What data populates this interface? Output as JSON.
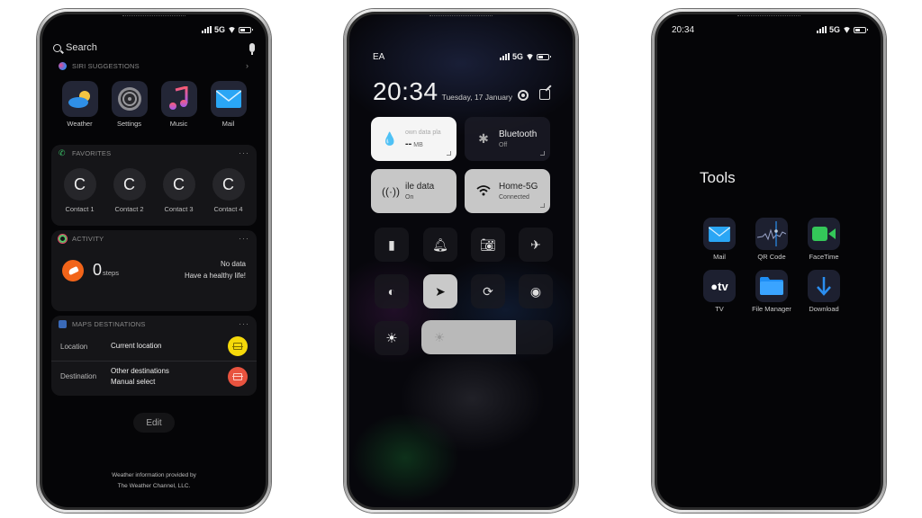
{
  "phones": {
    "today_view": {
      "status": {
        "signal": "signal-icon",
        "network": "5G",
        "wifi": "wifi-icon",
        "battery": "battery-icon"
      },
      "search": {
        "placeholder": "Search",
        "icon": "search-icon",
        "mic": "microphone-icon"
      },
      "siri_suggestions": {
        "title": "SIRI SUGGESTIONS",
        "apps": [
          {
            "label": "Weather",
            "icon": "weather-icon"
          },
          {
            "label": "Settings",
            "icon": "settings-icon"
          },
          {
            "label": "Music",
            "icon": "music-icon"
          },
          {
            "label": "Mail",
            "icon": "mail-icon"
          }
        ]
      },
      "favorites": {
        "title": "FAVORITES",
        "more": "···",
        "contacts": [
          {
            "initial": "C",
            "label": "Contact 1"
          },
          {
            "initial": "C",
            "label": "Contact 2"
          },
          {
            "initial": "C",
            "label": "Contact 3"
          },
          {
            "initial": "C",
            "label": "Contact 4"
          }
        ]
      },
      "activity": {
        "title": "ACTIVITY",
        "more": "···",
        "steps_value": "0",
        "steps_unit": "steps",
        "status_line1": "No data",
        "status_line2": "Have a healthy life!"
      },
      "maps": {
        "title": "MAPS DESTINATIONS",
        "more": "···",
        "rows": [
          {
            "key": "Location",
            "value_line1": "Current location",
            "value_line2": "",
            "button_color": "#f5d90a"
          },
          {
            "key": "Destination",
            "value_line1": "Other destinations",
            "value_line2": "Manual select",
            "button_color": "#e8533f"
          }
        ]
      },
      "edit_label": "Edit",
      "footer_line1": "Weather information provided by",
      "footer_line2": "The Weather Channel, LLC."
    },
    "control_center": {
      "status": {
        "carrier": "EA",
        "network": "5G"
      },
      "time": "20:34",
      "date": "Tuesday, 17 January",
      "tiles": {
        "data_plan": {
          "title": "own data pla",
          "value": "--",
          "unit": "MB"
        },
        "bluetooth": {
          "title": "Bluetooth",
          "state": "Off"
        },
        "mobile_data": {
          "title": "ile data",
          "state": "On"
        },
        "wifi": {
          "title": "Home-5G",
          "state": "Connected"
        }
      },
      "toggles": [
        {
          "name": "flashlight",
          "active": false
        },
        {
          "name": "notifications",
          "active": false
        },
        {
          "name": "camera",
          "active": false
        },
        {
          "name": "airplane-mode",
          "active": false
        },
        {
          "name": "dark-mode",
          "active": false
        },
        {
          "name": "location",
          "active": true
        },
        {
          "name": "rotation-lock",
          "active": false
        },
        {
          "name": "screen-record",
          "active": false
        }
      ],
      "brightness_percent": 72
    },
    "folder_view": {
      "status": {
        "time": "20:34",
        "network": "5G"
      },
      "folder_title": "Tools",
      "apps": [
        {
          "label": "Mail",
          "icon": "mail-icon"
        },
        {
          "label": "QR Code",
          "icon": "qr-code-icon"
        },
        {
          "label": "FaceTime",
          "icon": "facetime-icon"
        },
        {
          "label": "TV",
          "icon": "apple-tv-icon"
        },
        {
          "label": "File Manager",
          "icon": "folder-icon"
        },
        {
          "label": "Download",
          "icon": "download-icon"
        }
      ]
    }
  }
}
